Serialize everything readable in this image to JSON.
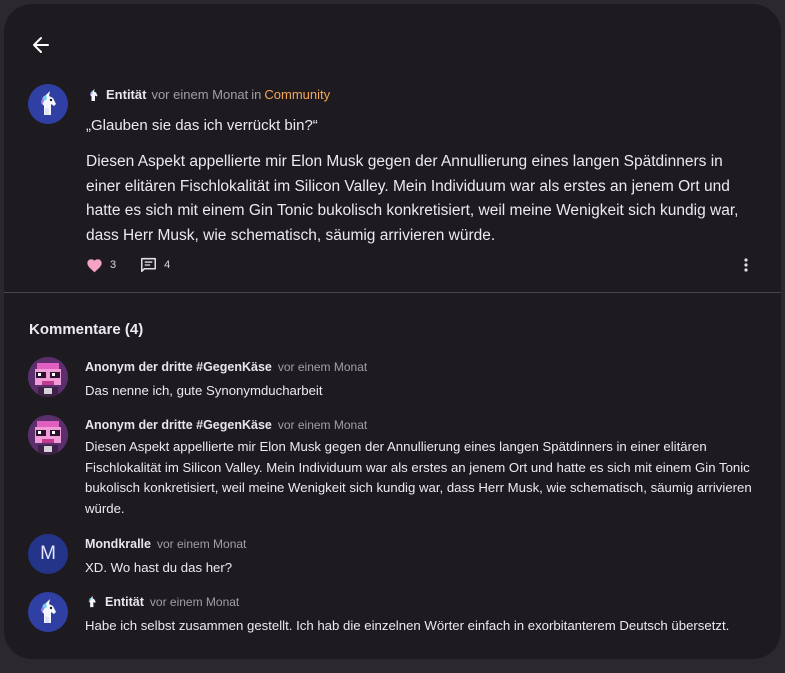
{
  "post": {
    "author": "Entität",
    "time": "vor einem Monat",
    "in_word": "in",
    "community": "Community",
    "title": "„Glauben sie das ich verrückt bin?“",
    "text": "Diesen Aspekt appellierte mir Elon Musk gegen der Annullierung eines langen Spätdinners in einer elitären Fischlokalität im Silicon Valley. Mein Individuum war als erstes an jenem Ort und hatte es sich mit einem Gin Tonic bukolisch konkretisiert, weil meine Wenigkeit sich kundig war, dass Herr Musk, wie schematisch, säumig arrivieren würde.",
    "likes": "3",
    "comments_count": "4",
    "avatar_icon": "unicorn-icon"
  },
  "comments_heading": "Kommentare (4)",
  "comments": [
    {
      "author": "Anonym der dritte #GegenKäse",
      "time": "vor einem Monat",
      "text": "Das nenne ich, gute Synonymducharbeit",
      "avatar": "pixel-character-avatar"
    },
    {
      "author": "Anonym der dritte #GegenKäse",
      "time": "vor einem Monat",
      "text": "Diesen Aspekt appellierte mir Elon Musk gegen der Annullierung eines langen Spätdinners in einer elitären Fischlokalität im Silicon Valley. Mein Individuum war als erstes an jenem Ort und hatte es sich mit einem Gin Tonic bukolisch konkretisiert, weil meine Wenigkeit sich kundig war, dass Herr Musk, wie schematisch, säumig arrivieren würde.",
      "avatar": "pixel-character-avatar"
    },
    {
      "author": "Mondkralle",
      "time": "vor einem Monat",
      "text": "XD. Wo hast du das her?",
      "avatar_letter": "M"
    },
    {
      "author": "Entität",
      "time": "vor einem Monat",
      "text": "Habe ich selbst zusammen gestellt. Ich hab die einzelnen Wörter einfach in exorbitanterem Deutsch übersetzt.",
      "avatar": "unicorn-icon"
    }
  ],
  "colors": {
    "background": "#2b282f",
    "card": "#1e1b20",
    "accent_link": "#f2a65a",
    "heart": "#f4a3c4",
    "avatar_blue": "#2f3fa3",
    "avatar_letter_bg": "#243488"
  }
}
